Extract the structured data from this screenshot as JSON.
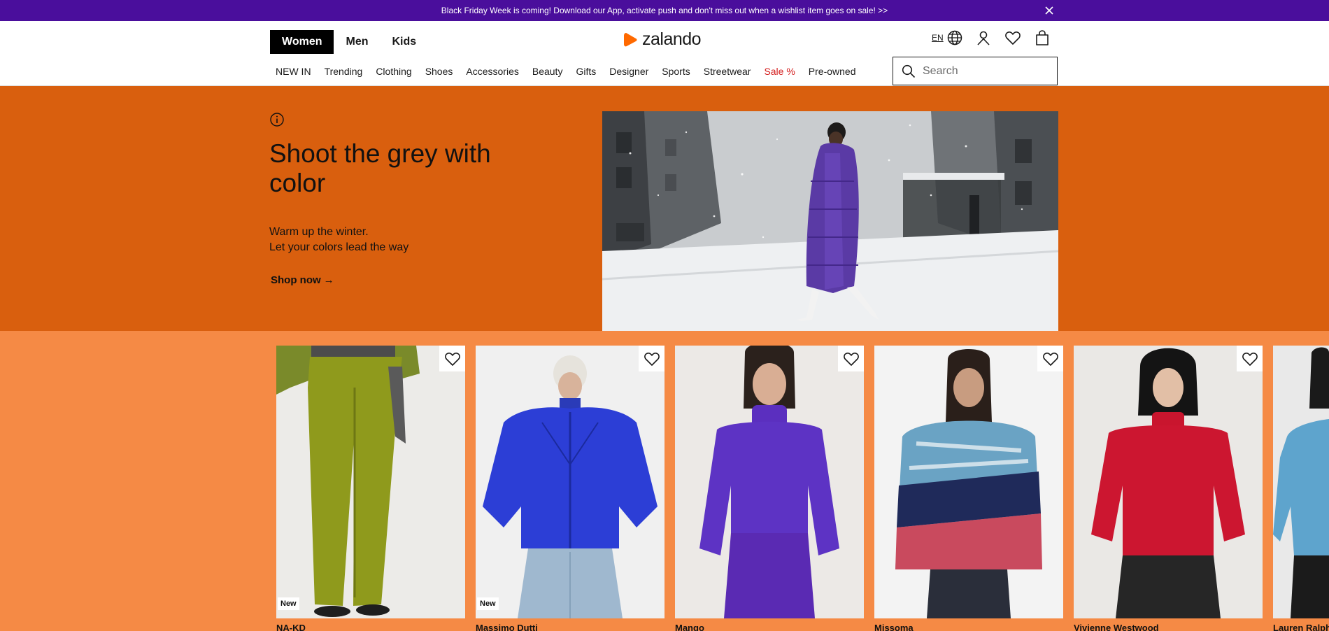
{
  "promo": {
    "text": "Black Friday Week is coming! Download our App, activate push and don't miss out when a wishlist item goes on sale! >>"
  },
  "header": {
    "gender_tabs": [
      {
        "label": "Women",
        "active": true
      },
      {
        "label": "Men",
        "active": false
      },
      {
        "label": "Kids",
        "active": false
      }
    ],
    "logo_text": "zalando",
    "language": "EN",
    "categories": [
      {
        "label": "NEW IN"
      },
      {
        "label": "Trending"
      },
      {
        "label": "Clothing"
      },
      {
        "label": "Shoes"
      },
      {
        "label": "Accessories"
      },
      {
        "label": "Beauty"
      },
      {
        "label": "Gifts"
      },
      {
        "label": "Designer"
      },
      {
        "label": "Sports"
      },
      {
        "label": "Streetwear"
      },
      {
        "label": "Sale %"
      },
      {
        "label": "Pre-owned"
      }
    ],
    "search_placeholder": "Search"
  },
  "hero": {
    "title": "Shoot the grey with color",
    "subtitle_line1": "Warm up the winter.",
    "subtitle_line2": "Let your colors lead the way",
    "cta": "Shop now",
    "cta_arrow": "→"
  },
  "products": [
    {
      "brand": "NA-KD",
      "badge": "New"
    },
    {
      "brand": "Massimo Dutti",
      "badge": "New"
    },
    {
      "brand": "Mango",
      "badge": ""
    },
    {
      "brand": "Missoma",
      "badge": ""
    },
    {
      "brand": "Vivienne Westwood",
      "badge": ""
    },
    {
      "brand": "Lauren Ralph",
      "badge": ""
    }
  ],
  "colors": {
    "promo_bg": "#4a0e9c",
    "hero_bg": "#d95f0e",
    "carousel_bg": "#f58a45",
    "logo_orange": "#ff6900",
    "sale_red": "#d41e1e"
  },
  "icons": [
    "close-icon",
    "zalando-logo-icon",
    "globe-icon",
    "user-icon",
    "heart-icon",
    "bag-icon",
    "search-icon",
    "info-icon",
    "arrow-right-icon"
  ]
}
